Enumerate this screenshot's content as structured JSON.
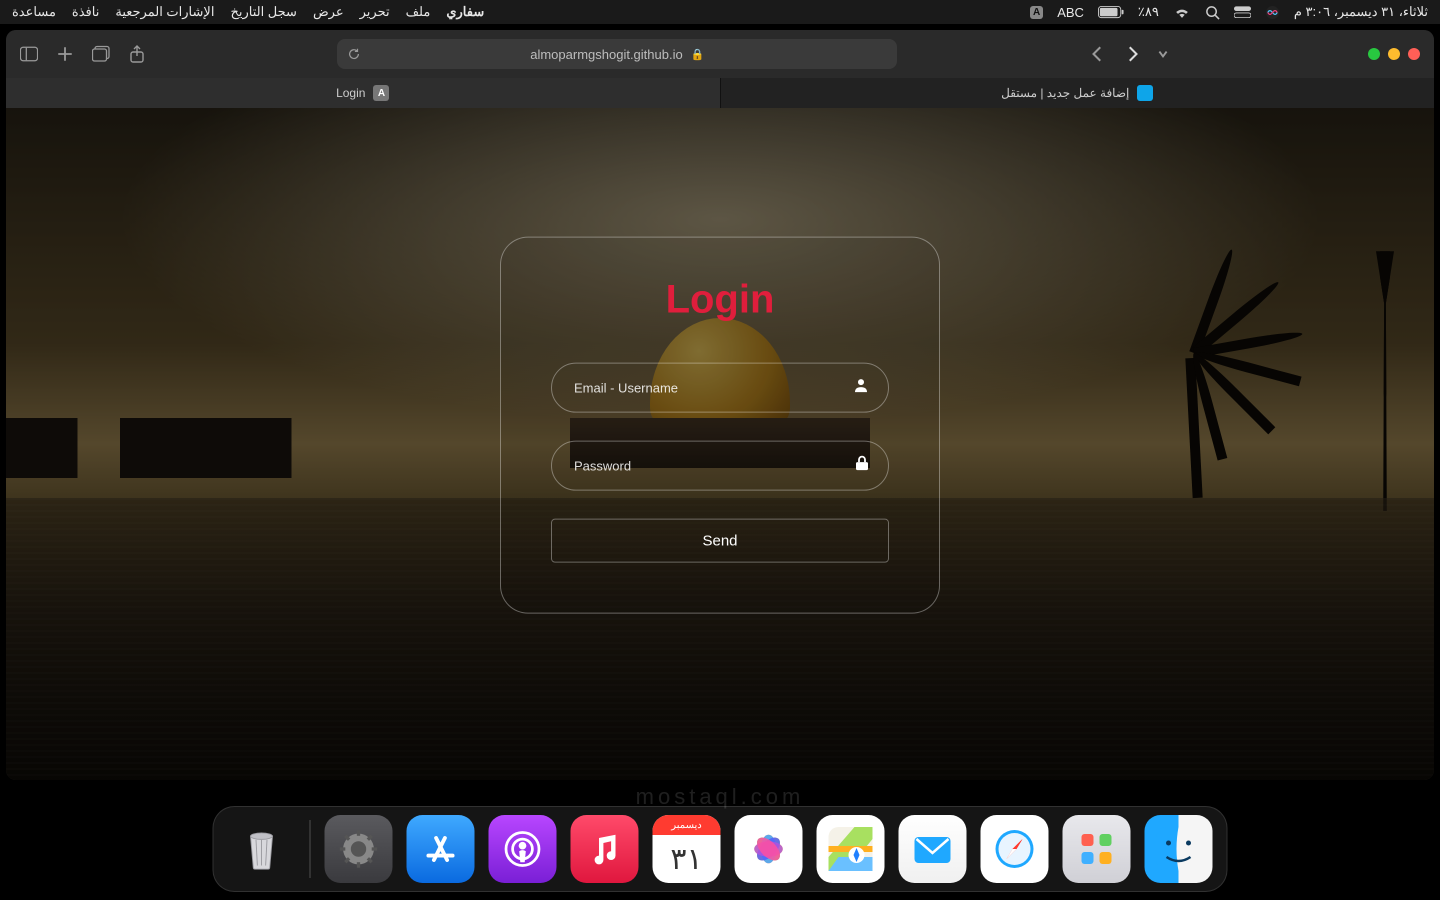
{
  "menubar": {
    "app": "سفاري",
    "items": [
      "ملف",
      "تحرير",
      "عرض",
      "سجل التاريخ",
      "الإشارات المرجعية",
      "نافذة",
      "مساعدة"
    ],
    "input_label": "ABC",
    "battery": "٪٨٩",
    "datetime": "ثلاثاء، ٣١ ديسمبر، ٣:٠٦ م"
  },
  "safari": {
    "url": "almoparmgshogit.github.io",
    "tabs": [
      {
        "label": "Login",
        "favicon": "A"
      },
      {
        "label": "إضافة عمل جديد | مستقل",
        "favicon": "circle"
      }
    ]
  },
  "login": {
    "title": "Login",
    "email_placeholder": "Email - Username",
    "password_placeholder": "Password",
    "send": "Send"
  },
  "dock": {
    "calendar_month": "ديسمبر",
    "calendar_day": "٣١"
  },
  "watermark": "mostaql.com"
}
